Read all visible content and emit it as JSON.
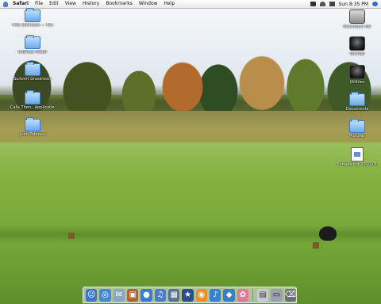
{
  "menubar": {
    "app_name": "Safari",
    "items": [
      "File",
      "Edit",
      "View",
      "History",
      "Bookmarks",
      "Window",
      "Help"
    ],
    "clock": "Sun 8:35 PM"
  },
  "desktop_icons_left": [
    {
      "label": "Title Unknown — Fav",
      "kind": "folder"
    },
    {
      "label": "Untitled Folder",
      "kind": "folder"
    },
    {
      "label": "Summit Grassroots",
      "kind": "folder"
    },
    {
      "label": "Calls Then...Applications",
      "kind": "folder"
    },
    {
      "label": "John Tabman",
      "kind": "folder"
    }
  ],
  "desktop_icons_right": [
    {
      "label": "Macintosh HD",
      "kind": "disk"
    },
    {
      "label": "Backup",
      "kind": "disk-dark"
    },
    {
      "label": "Utilities",
      "kind": "disk-dark"
    },
    {
      "label": "Documents",
      "kind": "folder"
    },
    {
      "label": "Pictures",
      "kind": "folder"
    },
    {
      "label": "Screenshot 2010-01",
      "kind": "doc"
    }
  ],
  "dock": {
    "items": [
      {
        "name": "finder-icon",
        "glyph": "☺",
        "color": "#3f74c9"
      },
      {
        "name": "safari-icon",
        "glyph": "◎",
        "color": "#4a86d8"
      },
      {
        "name": "mail-icon",
        "glyph": "✉",
        "color": "#8aa6c7"
      },
      {
        "name": "photo-icon",
        "glyph": "▣",
        "color": "#b0612f"
      },
      {
        "name": "ichat-icon",
        "glyph": "●",
        "color": "#3b7bd4"
      },
      {
        "name": "itunes-icon",
        "glyph": "♫",
        "color": "#4d7cc8"
      },
      {
        "name": "iphoto-icon",
        "glyph": "▦",
        "color": "#5a6f8f"
      },
      {
        "name": "imovie-icon",
        "glyph": "★",
        "color": "#2e4b8f"
      },
      {
        "name": "idvd-icon",
        "glyph": "◉",
        "color": "#f08d2a"
      },
      {
        "name": "garageband-icon",
        "glyph": "♪",
        "color": "#3b7fd1"
      },
      {
        "name": "preview-icon",
        "glyph": "◆",
        "color": "#3a7cc7"
      },
      {
        "name": "system-prefs-icon",
        "glyph": "✿",
        "color": "#e07a9a"
      },
      {
        "name": "document-icon",
        "glyph": "▤",
        "color": "#c9ccd2"
      },
      {
        "name": "screen-icon",
        "glyph": "▭",
        "color": "#9aa1ad"
      },
      {
        "name": "trash-icon",
        "glyph": "⌫",
        "color": "#6c7075"
      }
    ]
  },
  "colors": {
    "menubar_bg": "#e7e7e7",
    "fairway_green": "#7fae3d",
    "folder_blue": "#6aa8ea"
  }
}
